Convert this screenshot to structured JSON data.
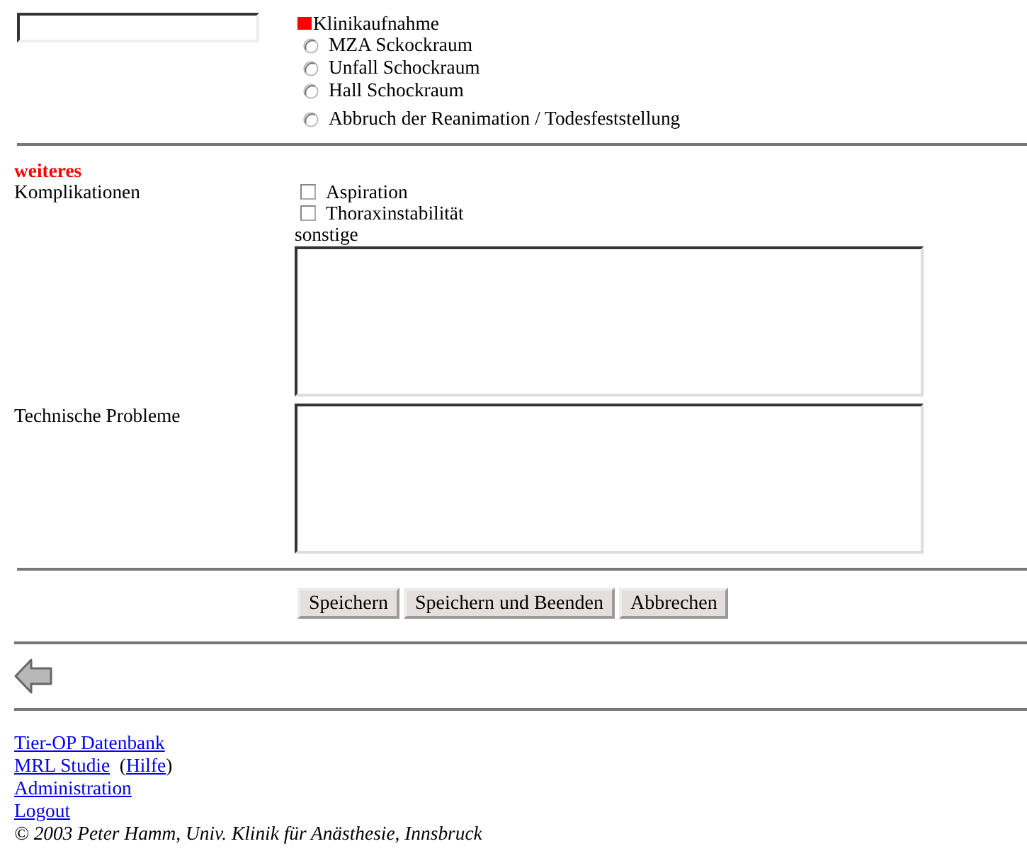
{
  "admission": {
    "label": "Klinikaufnahme",
    "required": true,
    "options": [
      {
        "label": "MZA Sckockraum",
        "selected": false
      },
      {
        "label": "Unfall Schockraum",
        "selected": false
      },
      {
        "label": "Hall Schockraum",
        "selected": false
      },
      {
        "label": "Abbruch der Reanimation / Todesfeststellung",
        "selected": false
      }
    ]
  },
  "section": {
    "title": "weiteres"
  },
  "complications": {
    "label": "Komplikationen",
    "options": [
      {
        "label": "Aspiration",
        "checked": false
      },
      {
        "label": "Thoraxinstabilität",
        "checked": false
      }
    ],
    "other_label": "sonstige"
  },
  "technical": {
    "label": "Technische Probleme"
  },
  "buttons": [
    "Speichern",
    "Speichern und Beenden",
    "Abbrechen"
  ],
  "footer": {
    "links": [
      {
        "label": "Tier-OP Datenbank"
      },
      {
        "label": "MRL Studie",
        "help": {
          "before": "(",
          "label": "Hilfe",
          "after": ")"
        }
      },
      {
        "label": "Administration"
      },
      {
        "label": "Logout"
      }
    ],
    "copyright": "© 2003 Peter Hamm, Univ. Klinik für Anästhesie, Innsbruck"
  }
}
